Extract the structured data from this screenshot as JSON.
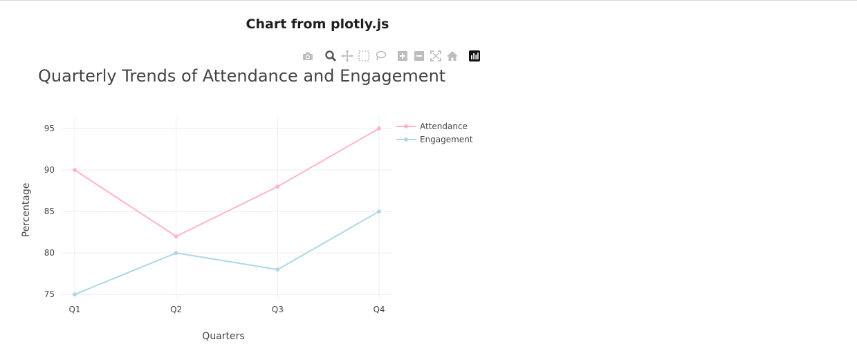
{
  "page": {
    "heading": "Chart from plotly.js"
  },
  "modebar": {
    "buttons": [
      {
        "name": "camera-icon"
      },
      {
        "name": "zoom-icon"
      },
      {
        "name": "pan-icon"
      },
      {
        "name": "box-select-icon"
      },
      {
        "name": "lasso-select-icon"
      },
      {
        "name": "zoom-in-icon"
      },
      {
        "name": "zoom-out-icon"
      },
      {
        "name": "autoscale-icon"
      },
      {
        "name": "home-icon"
      },
      {
        "name": "plotly-logo-icon"
      }
    ]
  },
  "chart_data": {
    "type": "line",
    "title": "Quarterly Trends of Attendance and Engagement",
    "xlabel": "Quarters",
    "ylabel": "Percentage",
    "categories": [
      "Q1",
      "Q2",
      "Q3",
      "Q4"
    ],
    "ylim": [
      74.6,
      96.5
    ],
    "yticks": [
      75,
      80,
      85,
      90,
      95
    ],
    "grid": true,
    "legend_position": "top-right",
    "series": [
      {
        "name": "Attendance",
        "values": [
          90,
          82,
          88,
          95
        ],
        "color": "#ffb6c1"
      },
      {
        "name": "Engagement",
        "values": [
          75,
          80,
          78,
          85
        ],
        "color": "#add8e6"
      }
    ]
  }
}
